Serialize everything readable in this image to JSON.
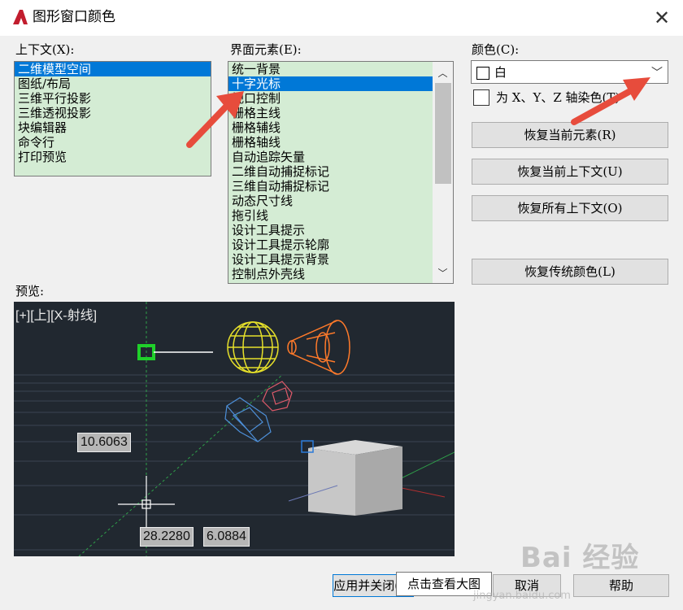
{
  "window": {
    "title": "图形窗口颜色",
    "close_glyph": "✕"
  },
  "context": {
    "label": "上下文(X):",
    "items": [
      "二维模型空间",
      "图纸/布局",
      "三维平行投影",
      "三维透视投影",
      "块编辑器",
      "命令行",
      "打印预览"
    ],
    "selected_index": 0
  },
  "interface_element": {
    "label": "界面元素(E):",
    "items": [
      "统一背景",
      "十字光标",
      "视口控制",
      "栅格主线",
      "栅格辅线",
      "栅格轴线",
      "自动追踪矢量",
      "二维自动捕捉标记",
      "三维自动捕捉标记",
      "动态尺寸线",
      "拖引线",
      "设计工具提示",
      "设计工具提示轮廓",
      "设计工具提示背景",
      "控制点外壳线"
    ],
    "selected_index": 1,
    "scroll_up": "︿",
    "scroll_down": "﹀"
  },
  "color": {
    "label": "颜色(C):",
    "value": "白",
    "swatch": "#ffffff",
    "dropdown_glyph": "﹀",
    "tint_label": "为 X、Y、Z 轴染色(T)",
    "tint_checked": false
  },
  "buttons": {
    "restore_element": "恢复当前元素(R)",
    "restore_context": "恢复当前上下文(U)",
    "restore_all": "恢复所有上下文(O)",
    "restore_classic": "恢复传统颜色(L)",
    "apply_close": "应用并关闭(A)",
    "cancel": "取消",
    "help": "帮助"
  },
  "preview": {
    "label": "预览:",
    "viewport_label": "[+][上][X-射线]",
    "readout_a": "10.6063",
    "readout_b": "28.2280",
    "readout_c": "6.0884"
  },
  "tooltip": {
    "text": "点击查看大图"
  },
  "watermark": {
    "text": "Bai 经验",
    "sub": "jingyan.baidu.com"
  },
  "colors": {
    "selection": "#0078d7",
    "list_bg": "#d4ecd4",
    "preview_bg": "#212830",
    "arrow": "#e74c3c"
  }
}
